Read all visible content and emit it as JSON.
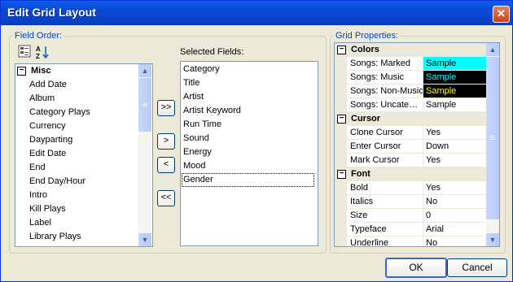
{
  "window": {
    "title": "Edit Grid Layout",
    "close_glyph": "✕"
  },
  "field_order": {
    "legend": "Field Order:",
    "category": "Misc",
    "items": [
      "Add Date",
      "Album",
      "Category Plays",
      "Currency",
      "Dayparting",
      "Edit Date",
      "End",
      "End Day/Hour",
      "Intro",
      "Kill Plays",
      "Label",
      "Library Plays"
    ],
    "toolbar_icons": [
      "categorized-view-icon",
      "sort-az-icon"
    ]
  },
  "selected_fields": {
    "label": "Selected Fields:",
    "items": [
      "Category",
      "Title",
      "Artist",
      "Artist Keyword",
      "Run Time",
      "Sound",
      "Energy",
      "Mood",
      "Gender"
    ],
    "focused": "Gender"
  },
  "move_buttons": {
    "add_all": ">>",
    "add": ">",
    "remove": "<",
    "remove_all": "<<"
  },
  "grid_properties": {
    "legend": "Grid Properties:",
    "sections": [
      {
        "name": "Colors",
        "rows": [
          {
            "key": "Songs: Marked",
            "value": "Sample",
            "bg": "#00ffff",
            "fg": "#000000"
          },
          {
            "key": "Songs: Music",
            "value": "Sample",
            "bg": "#000000",
            "fg": "#00ffff"
          },
          {
            "key": "Songs: Non-Music",
            "value": "Sample",
            "bg": "#000000",
            "fg": "#ffff00"
          },
          {
            "key": "Songs: Uncate…",
            "value": "Sample",
            "bg": "#ffffff",
            "fg": "#000000"
          }
        ]
      },
      {
        "name": "Cursor",
        "rows": [
          {
            "key": "Clone Cursor",
            "value": "Yes"
          },
          {
            "key": "Enter Cursor",
            "value": "Down"
          },
          {
            "key": "Mark Cursor",
            "value": "Yes"
          }
        ]
      },
      {
        "name": "Font",
        "rows": [
          {
            "key": "Bold",
            "value": "Yes"
          },
          {
            "key": "Italics",
            "value": "No"
          },
          {
            "key": "Size",
            "value": "0"
          },
          {
            "key": "Typeface",
            "value": "Arial"
          },
          {
            "key": "Underline",
            "value": "No"
          }
        ]
      }
    ]
  },
  "buttons": {
    "ok": "OK",
    "cancel": "Cancel"
  }
}
